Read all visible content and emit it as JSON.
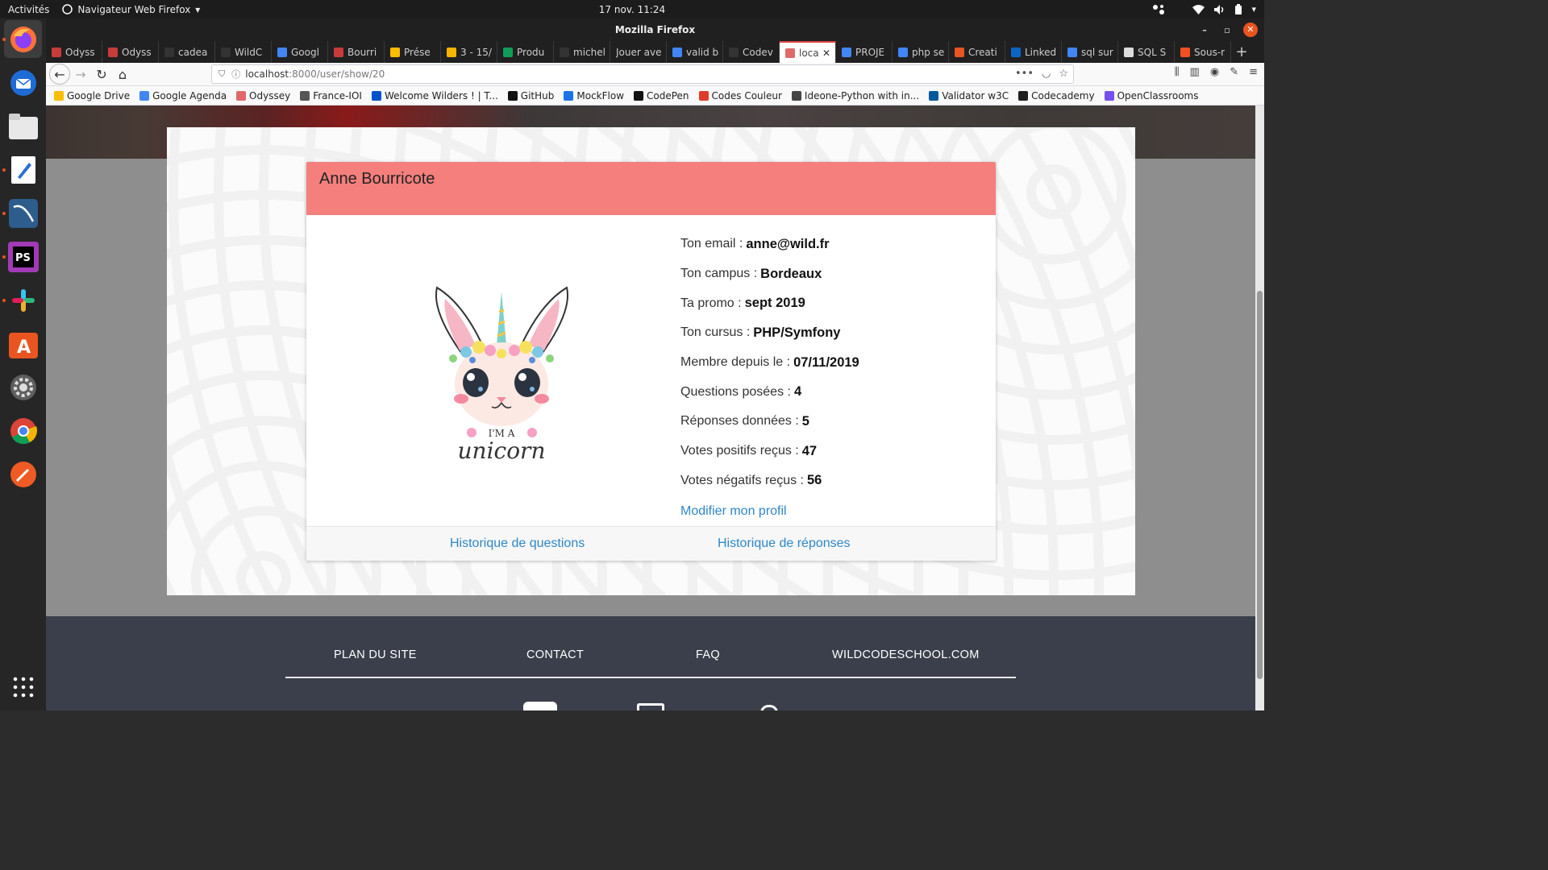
{
  "topbar": {
    "activities": "Activités",
    "app_menu": "Navigateur Web Firefox",
    "clock": "17 nov.  11:24"
  },
  "window": {
    "title": "Mozilla Firefox"
  },
  "tabs": [
    {
      "label": "Odyss",
      "color": "#c73b3b"
    },
    {
      "label": "Odyss",
      "color": "#c73b3b"
    },
    {
      "label": "cadea",
      "color": "#333333"
    },
    {
      "label": "WildC",
      "color": "#333333"
    },
    {
      "label": "Googl",
      "color": "#4285f4"
    },
    {
      "label": "Bourri",
      "color": "#c73b3b"
    },
    {
      "label": "Prése",
      "color": "#fbbc04"
    },
    {
      "label": "3 - 15/",
      "color": "#f4b400"
    },
    {
      "label": "Produ",
      "color": "#0f9d58"
    },
    {
      "label": "michel",
      "color": "#333333"
    },
    {
      "label": "Jouer ave",
      "color": ""
    },
    {
      "label": "valid b",
      "color": "#4285f4"
    },
    {
      "label": "Codev",
      "color": "#333333"
    },
    {
      "label": "loca",
      "color": "#e06a6a",
      "active": true
    },
    {
      "label": "PROJE",
      "color": "#4285f4"
    },
    {
      "label": "php se",
      "color": "#4285f4"
    },
    {
      "label": "Creati",
      "color": "#e95420"
    },
    {
      "label": "Linked",
      "color": "#0a66c2"
    },
    {
      "label": "sql sur",
      "color": "#4285f4"
    },
    {
      "label": "SQL S",
      "color": "#dddddd"
    },
    {
      "label": "Sous-r",
      "color": "#f25022"
    }
  ],
  "url": {
    "host": "localhost",
    "path": ":8000/user/show/20"
  },
  "bookmarks": [
    {
      "label": "Google Drive",
      "color": "#fbbc04"
    },
    {
      "label": "Google Agenda",
      "color": "#4285f4"
    },
    {
      "label": "Odyssey",
      "color": "#e06a6a"
    },
    {
      "label": "France-IOI",
      "color": "#555555"
    },
    {
      "label": "Welcome Wilders ! | T...",
      "color": "#0052cc"
    },
    {
      "label": "GitHub",
      "color": "#111111"
    },
    {
      "label": "MockFlow",
      "color": "#1a73e8"
    },
    {
      "label": "CodePen",
      "color": "#111111"
    },
    {
      "label": "Codes Couleur",
      "color": "#e03c28"
    },
    {
      "label": "Ideone-Python with in...",
      "color": "#444444"
    },
    {
      "label": "Validator w3C",
      "color": "#005a9c"
    },
    {
      "label": "Codecademy",
      "color": "#1f1f1f"
    },
    {
      "label": "OpenClassrooms",
      "color": "#7451eb"
    }
  ],
  "profile": {
    "name": "Anne Bourricote",
    "avatar_caption_top": "I'M A",
    "avatar_caption": "unicorn",
    "fields": [
      {
        "label": "Ton email :",
        "value": "anne@wild.fr"
      },
      {
        "label": "Ton campus :",
        "value": "Bordeaux"
      },
      {
        "label": "Ta promo :",
        "value": "sept 2019"
      },
      {
        "label": "Ton cursus :",
        "value": "PHP/Symfony"
      },
      {
        "label": "Membre depuis le :",
        "value": "07/11/2019"
      },
      {
        "label": "Questions posées :",
        "value": "4"
      },
      {
        "label": "Réponses données :",
        "value": "5"
      },
      {
        "label": "Votes positifs reçus :",
        "value": "47"
      },
      {
        "label": "Votes négatifs reçus :",
        "value": "56"
      }
    ],
    "edit_link": "Modifier mon profil",
    "history_questions": "Historique de questions",
    "history_answers": "Historique de réponses"
  },
  "footer": {
    "links": [
      "PLAN DU SITE",
      "CONTACT",
      "FAQ",
      "WILDCODESCHOOL.COM"
    ]
  },
  "colors": {
    "header_accent": "#f47f7d",
    "link": "#2e86c9",
    "footer_bg": "#3a3f4b",
    "ubuntu_orange": "#e95420"
  }
}
